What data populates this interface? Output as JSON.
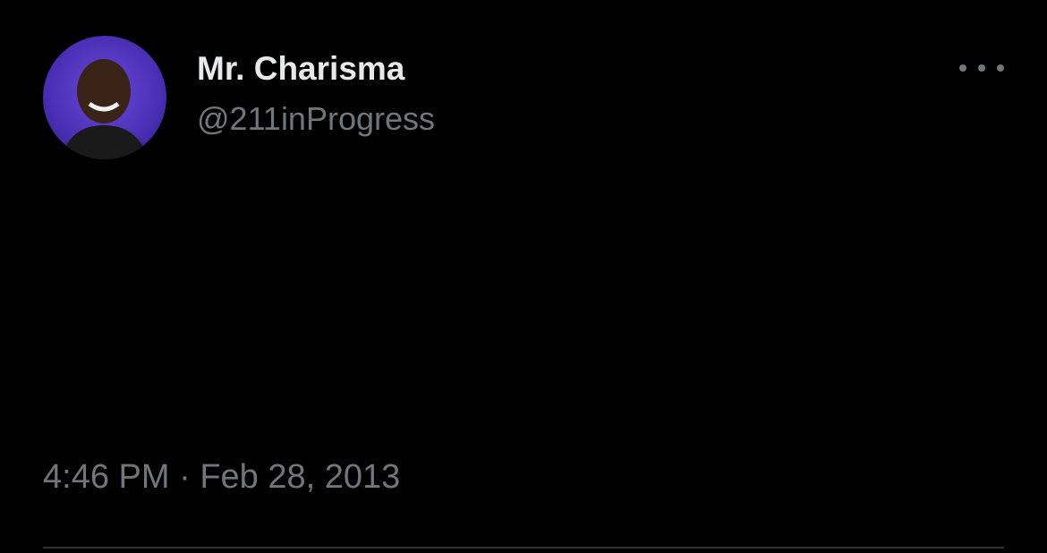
{
  "author": {
    "display_name": "Mr. Charisma",
    "handle": "@211inProgress",
    "avatar_icon": "profile-photo"
  },
  "tweet": {
    "text": "",
    "time": "4:46 PM",
    "separator": "·",
    "date": "Feb 28, 2013"
  },
  "menu": {
    "icon": "more-horizontal-icon"
  },
  "colors": {
    "background": "#000000",
    "primary_text": "#e7e9ea",
    "secondary_text": "#71767b",
    "divider": "#2f3336"
  }
}
